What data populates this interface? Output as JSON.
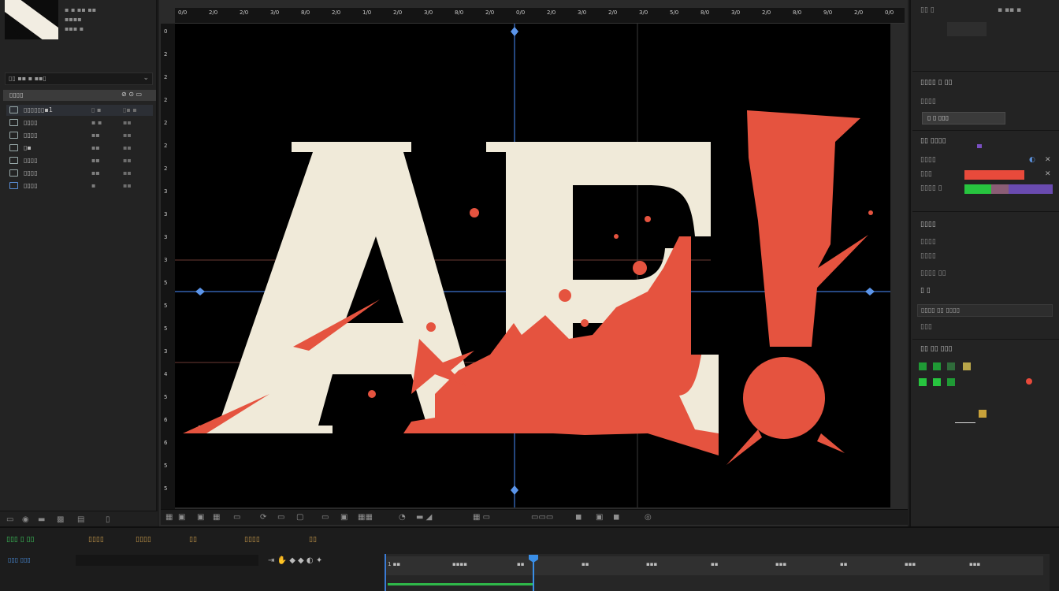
{
  "project": {
    "meta_lines": [
      "▪ ▪ ▪▪ ▪▪",
      "▪▪▪▪",
      "▪▪▪ ▪"
    ],
    "search_placeholder": "▯▯ ▪▪ ▪ ▪▪▯",
    "list_header": "▯▯▯▯",
    "items": [
      {
        "name": "▯▯▯▯▯▯▪1",
        "c2": "▯ ▪",
        "c3": "▯▪ ▪"
      },
      {
        "name": "▯▯▯▯",
        "c2": "▪ ▪",
        "c3": "▪▪"
      },
      {
        "name": "▯▯▯▯",
        "c2": "▪▪",
        "c3": "▪▪"
      },
      {
        "name": "▯▪",
        "c2": "▪▪",
        "c3": "▪▪"
      },
      {
        "name": "▯▯▯▯",
        "c2": "▪▪",
        "c3": "▪▪"
      },
      {
        "name": "▯▯▯▯",
        "c2": "▪▪",
        "c3": "▪▪"
      },
      {
        "name": "▯▯▯▯",
        "c2": "▪",
        "c3": "▪▪"
      }
    ]
  },
  "viewer": {
    "ruler_top_labels": [
      "0/0",
      "2/0",
      "2/0",
      "3/0",
      "8/0",
      "2/0",
      "1/0",
      "2/0",
      "3/0",
      "8/0",
      "2/0",
      "0/0",
      "2/0",
      "3/0",
      "2/0",
      "3/0",
      "5/0",
      "8/0",
      "3/0",
      "2/0",
      "8/0",
      "9/0",
      "2/0",
      "0/0"
    ],
    "ruler_left_labels": [
      "0",
      "2",
      "2",
      "2",
      "2",
      "2",
      "2",
      "3",
      "3",
      "3",
      "3",
      "5",
      "5",
      "5",
      "3",
      "4",
      "5",
      "6",
      "6",
      "5",
      "5"
    ],
    "text_main": "AE",
    "text_bang": "!",
    "colors": {
      "text": "#f0ead9",
      "splatter": "#e5533f",
      "guide": "#3d74d0",
      "bg": "#000000"
    }
  },
  "right": {
    "top_lines": [
      "▯▯ ▯",
      "▪ ▪▪ ▪",
      "▪▪▪▪"
    ],
    "panel1_title": "▯▯▯▯ ▯ ▯▯",
    "panel1_sub": "▯▯▯▯",
    "panel1_dropdown": "▯ ▯ ▯▯▯",
    "panel2_title": "▯▯ ▯▯▯▯",
    "swatch_rows": [
      "▯▯▯▯",
      "▯▯▯",
      "▯▯▯▯ ▯"
    ],
    "panel3_title": "▯▯▯▯",
    "panel3_lines": [
      "▯▯▯▯",
      "▯▯▯▯",
      "▯▯▯▯ ▯▯"
    ],
    "panel3_sub": "▯ ▯",
    "panel3_field": "▯▯▯▯ ▯▯ ▯▯▯▯",
    "panel3_field2": "▯▯▯",
    "panel4_title": "▯▯ ▯▯ ▯▯▯"
  },
  "timeline": {
    "tabs": [
      "▯▯▯ ▯ ▯▯",
      "▯▯▯▯",
      "▯▯▯▯",
      "▯▯",
      "▯▯▯▯",
      "▯▯"
    ],
    "timecode": "▯▯▯ ▯▯▯",
    "ruler_labels": [
      "1 ▪▪",
      "▪▪▪▪",
      "▪▪",
      "▪▪",
      "▪▪▪",
      "▪▪",
      "▪▪▪",
      "▪▪",
      "▪▪▪",
      "▪▪▪"
    ]
  }
}
